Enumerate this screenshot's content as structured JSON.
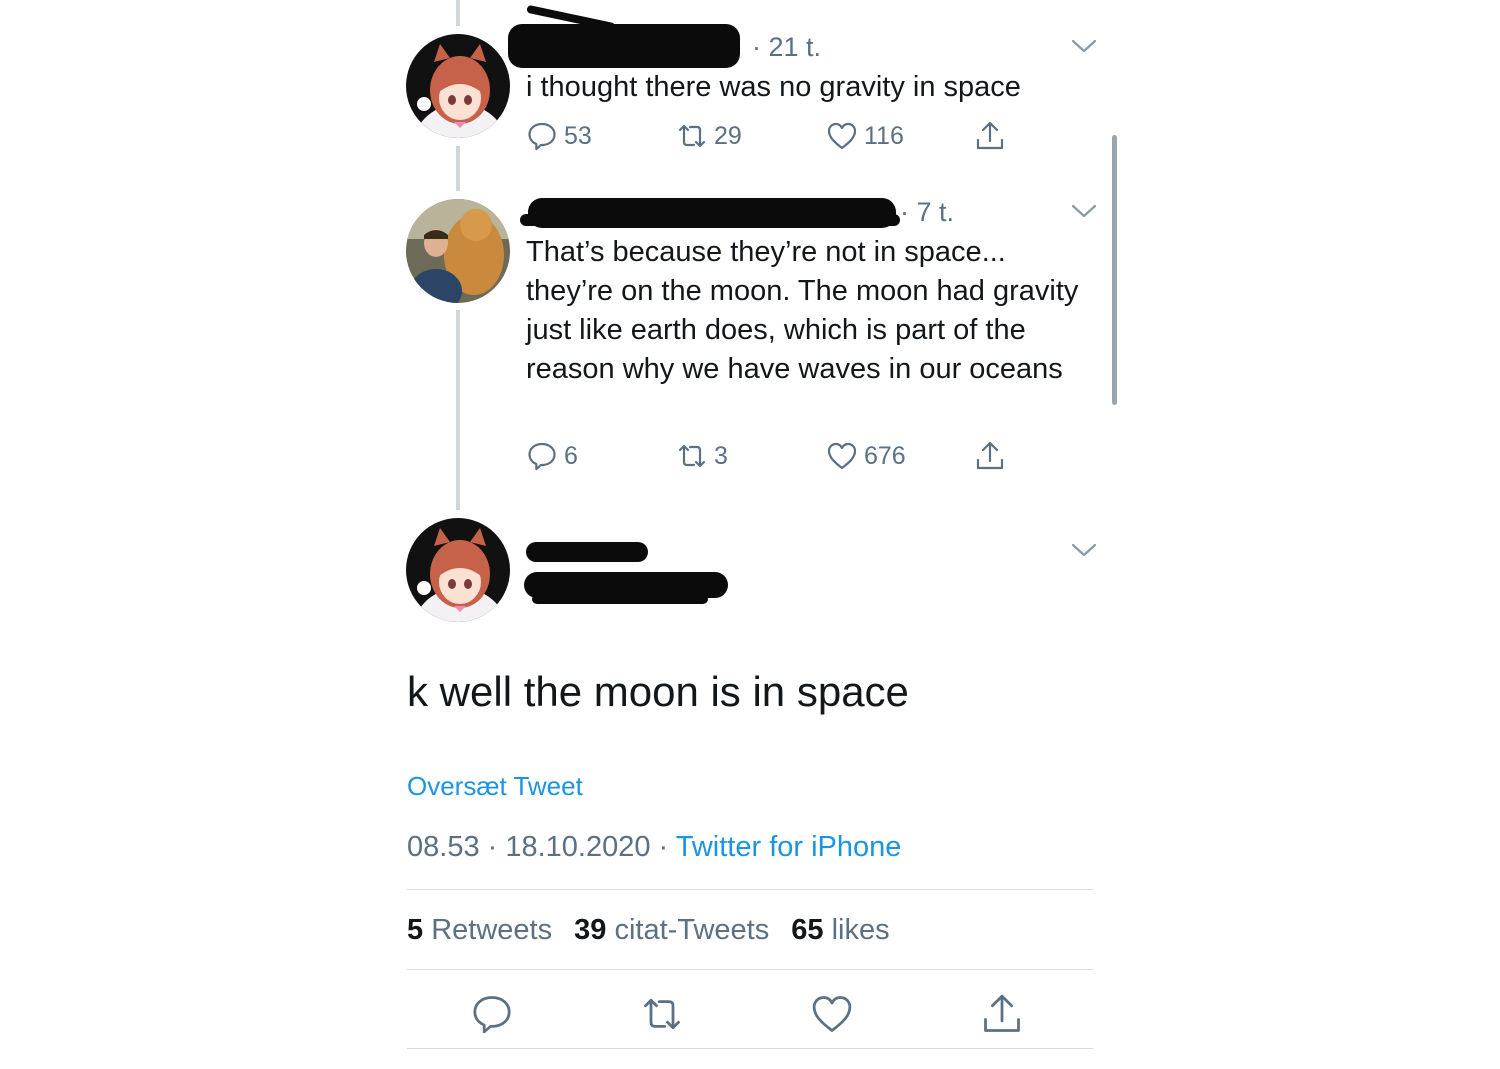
{
  "tweet1": {
    "time": "· 21 t.",
    "text": "i thought there was no gravity in space",
    "replies": "53",
    "retweets": "29",
    "likes": "116"
  },
  "tweet2": {
    "time": "· 7 t.",
    "text": "That’s because they’re not in space... they’re on the moon. The moon had gravity just like earth does, which is part of the reason why we have waves in our oceans",
    "replies": "6",
    "retweets": "3",
    "likes": "676"
  },
  "main_tweet": {
    "text": "k well the moon is in space",
    "translate_label": "Oversæt Tweet",
    "timestamp": "08.53 · 18.10.2020 ·",
    "source": "Twitter for iPhone"
  },
  "stats": {
    "retweets_count": "5",
    "retweets_label": "Retweets",
    "quotes_count": "39",
    "quotes_label": "citat-Tweets",
    "likes_count": "65",
    "likes_label": "likes"
  },
  "colors": {
    "accent": "#1b95e0",
    "secondary_text": "#5b7083",
    "thread_line": "#cfd6dc"
  },
  "icons": [
    "reply-icon",
    "retweet-icon",
    "like-icon",
    "share-icon",
    "chevron-down-icon"
  ]
}
